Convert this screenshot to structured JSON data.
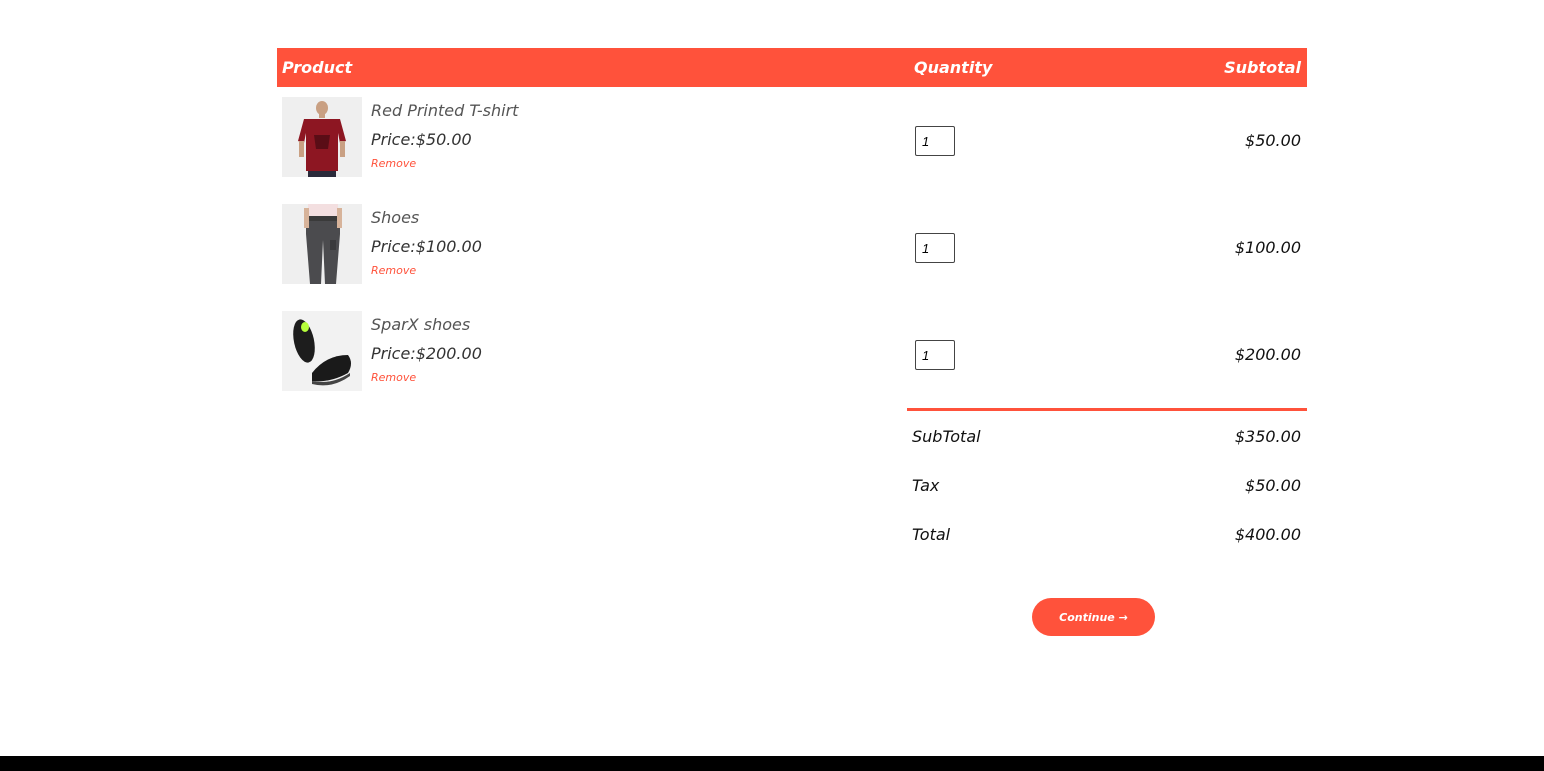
{
  "table": {
    "header": {
      "product": "Product",
      "quantity": "Quantity",
      "subtotal": "Subtotal"
    },
    "items": [
      {
        "name": "Red Printed T-shirt",
        "price": "Price:$50.00",
        "remove": "Remove",
        "quantity": "1",
        "subtotal": "$50.00",
        "image_icon": "red-tshirt-image"
      },
      {
        "name": "Shoes",
        "price": "Price:$100.00",
        "remove": "Remove",
        "quantity": "1",
        "subtotal": "$100.00",
        "image_icon": "grey-joggers-image"
      },
      {
        "name": "SparX shoes",
        "price": "Price:$200.00",
        "remove": "Remove",
        "quantity": "1",
        "subtotal": "$200.00",
        "image_icon": "black-sneakers-image"
      }
    ]
  },
  "totals": {
    "subtotal_label": "SubTotal",
    "subtotal_value": "$350.00",
    "tax_label": "Tax",
    "tax_value": "$50.00",
    "total_label": "Total",
    "total_value": "$400.00"
  },
  "actions": {
    "continue_label": "Continue →"
  },
  "colors": {
    "accent": "#ff523b",
    "footer": "#000000"
  }
}
